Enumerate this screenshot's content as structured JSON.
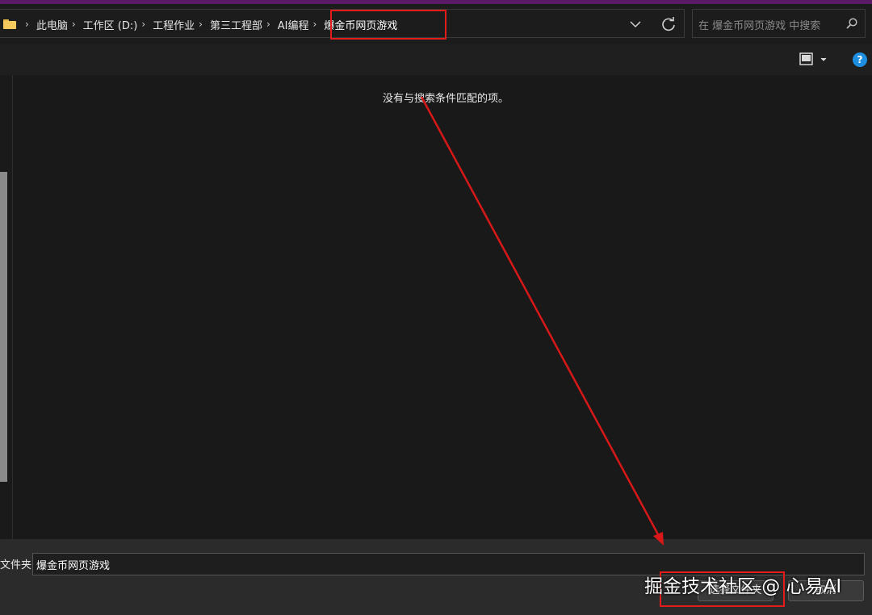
{
  "breadcrumb": {
    "items": [
      "此电脑",
      "工作区 (D:)",
      "工程作业",
      "第三工程部",
      "AI编程",
      "爆金币网页游戏"
    ]
  },
  "search": {
    "placeholder": "在 爆金币网页游戏 中搜索"
  },
  "toolbar": {
    "help_label": "?"
  },
  "content": {
    "empty_message": "没有与搜索条件匹配的项。"
  },
  "bottom": {
    "folder_label": "文件夹:",
    "folder_value": "爆金币网页游戏",
    "select_button": "选择文件夹",
    "cancel_button": "取消"
  },
  "watermark": {
    "text": "掘金技术社区 @ 心易AI"
  },
  "colors": {
    "highlight": "#e41b1b",
    "accent_stripe": "#5a1a66",
    "help_blue": "#1e8fe0"
  }
}
